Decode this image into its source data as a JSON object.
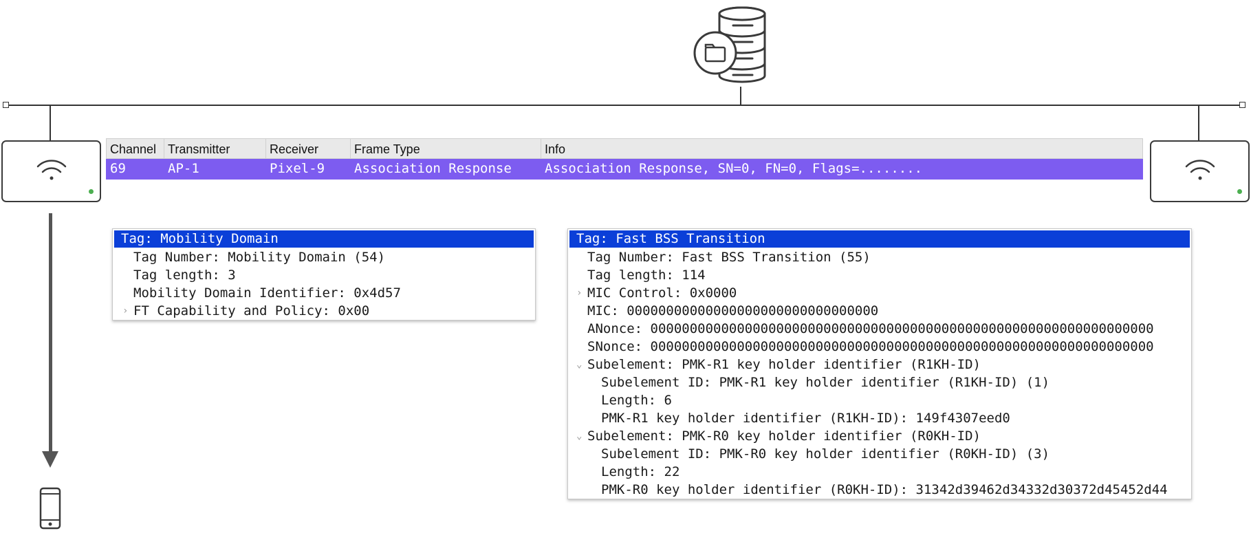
{
  "packet_list": {
    "headers": [
      "Channel",
      "Transmitter",
      "Receiver",
      "Frame Type",
      "Info"
    ],
    "row": [
      "69",
      "AP-1",
      "Pixel-9",
      "Association Response",
      "Association Response, SN=0, FN=0, Flags=........"
    ]
  },
  "mobility_domain": {
    "title": "Tag: Mobility Domain",
    "lines": [
      "Tag Number: Mobility Domain (54)",
      "Tag length: 3",
      "Mobility Domain Identifier: 0x4d57",
      "FT Capability and Policy: 0x00"
    ]
  },
  "fast_bss": {
    "title": "Tag: Fast BSS Transition",
    "lines": [
      "Tag Number: Fast BSS Transition (55)",
      "Tag length: 114",
      "MIC Control: 0x0000",
      "MIC: 00000000000000000000000000000000",
      "ANonce: 0000000000000000000000000000000000000000000000000000000000000000",
      "SNonce: 0000000000000000000000000000000000000000000000000000000000000000",
      "Subelement: PMK-R1 key holder identifier (R1KH-ID)",
      "Subelement ID: PMK-R1 key holder identifier (R1KH-ID) (1)",
      "Length: 6",
      "PMK-R1 key holder identifier (R1KH-ID): 149f4307eed0",
      "Subelement: PMK-R0 key holder identifier (R0KH-ID)",
      "Subelement ID: PMK-R0 key holder identifier (R0KH-ID) (3)",
      "Length: 22",
      "PMK-R0 key holder identifier (R0KH-ID): 31342d39462d34332d30372d45452d44"
    ]
  },
  "icons": [
    "database-icon",
    "folder-icon",
    "wifi-icon",
    "phone-icon"
  ],
  "colors": {
    "selected_row": "#7d5cf0",
    "selected_tag": "#0b3fd8",
    "status_led": "#4caf50"
  }
}
